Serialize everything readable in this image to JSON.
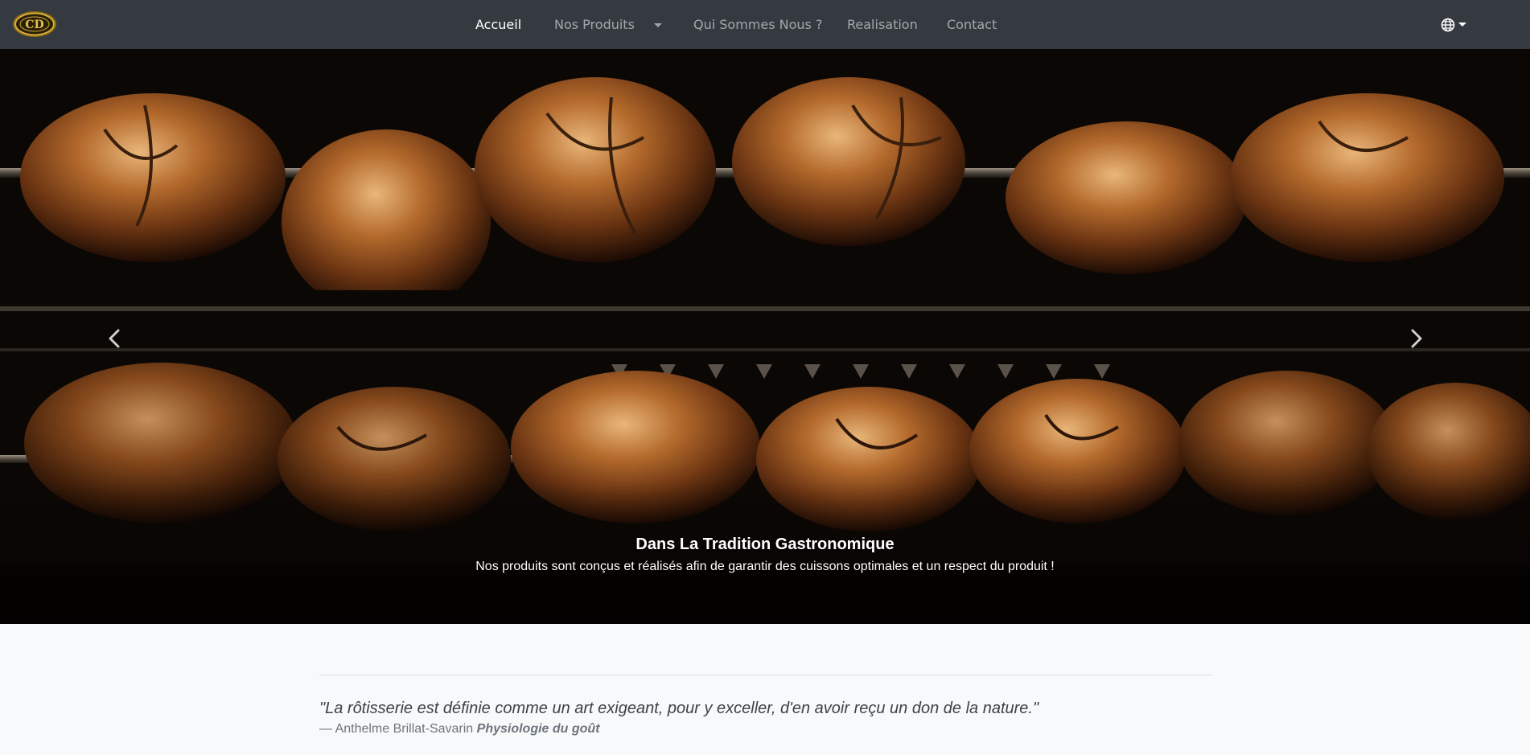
{
  "navbar": {
    "logo_text": "CD",
    "items": [
      {
        "label": "Accueil",
        "active": true
      },
      {
        "label": "Nos Produits",
        "dropdown": true
      },
      {
        "label": "Qui Sommes Nous ?"
      },
      {
        "label": "Realisation"
      },
      {
        "label": "Contact"
      }
    ],
    "language_icon": "globe-icon"
  },
  "carousel": {
    "prev_icon": "chevron-left-icon",
    "next_icon": "chevron-right-icon",
    "slide_image": "rotisserie-chickens-on-spits",
    "caption_title": "Dans La Tradition Gastronomique",
    "caption_text": "Nos produits sont conçus et réalisés afin de garantir des cuissons optimales et un respect du produit !"
  },
  "quote": {
    "text": "\"La rôtisserie est définie comme un art exigeant, pour y exceller, d'en avoir reçu un don de la nature.\"",
    "author": "— Anthelme Brillat-Savarin",
    "source": "Physiologie du goût"
  },
  "colors": {
    "navbar_bg": "#343a40",
    "page_bg": "#f8f9fa",
    "logo_gold": "#c9a227"
  }
}
